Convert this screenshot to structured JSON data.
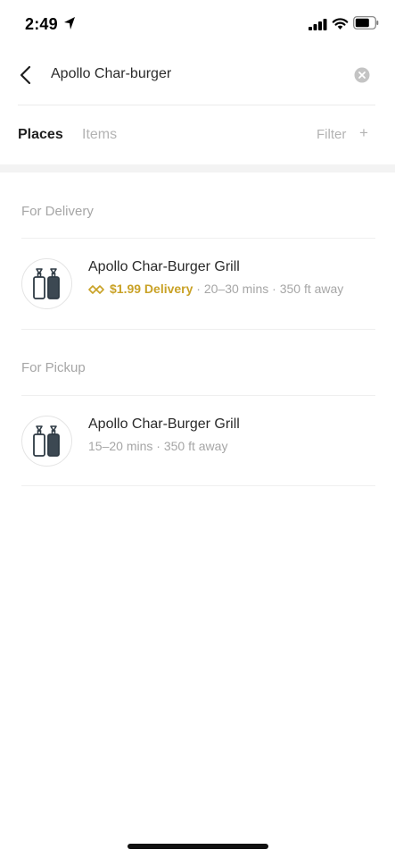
{
  "status_bar": {
    "time": "2:49"
  },
  "search": {
    "query": "Apollo Char-burger"
  },
  "tabs": [
    {
      "label": "Places",
      "active": true
    },
    {
      "label": "Items",
      "active": false
    }
  ],
  "filter": {
    "label": "Filter",
    "plus": "+"
  },
  "sections": {
    "delivery": {
      "title": "For Delivery",
      "result": {
        "name": "Apollo Char-Burger Grill",
        "fee": "$1.99 Delivery",
        "time": "20–30 mins",
        "distance": "350 ft away",
        "separator": "·"
      }
    },
    "pickup": {
      "title": "For Pickup",
      "result": {
        "name": "Apollo Char-Burger Grill",
        "time": "15–20 mins",
        "distance": "350 ft away",
        "separator": "·"
      }
    }
  },
  "colors": {
    "accent_gold": "#c9a227",
    "muted_gray": "#a6a6a6",
    "text_dark": "#2a2a2a"
  },
  "icons": [
    "location-arrow-icon",
    "signal-icon",
    "wifi-icon",
    "battery-icon",
    "back-chevron-icon",
    "clear-icon",
    "condiment-bottles-icon",
    "delivery-tag-icon"
  ]
}
